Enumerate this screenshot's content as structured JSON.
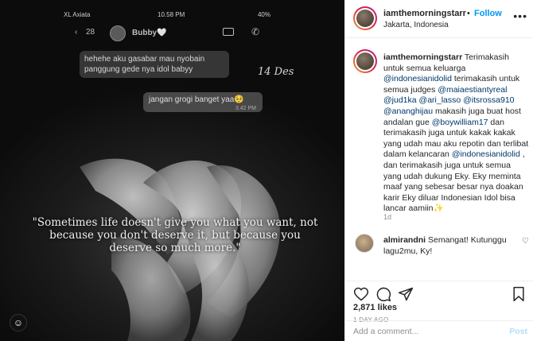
{
  "photo": {
    "status": {
      "carrier": "XL Axiata",
      "time": "10.58 PM",
      "battery": "40%"
    },
    "chat": {
      "back_count": "28",
      "contact": "Bubby🤍"
    },
    "message_in": "hehehe aku gasabar mau nyobain panggung gede nya idol babyy",
    "date_label": "14 Des",
    "message_out": "jangan grogi banget yaa🥺",
    "message_out_time": "3.42 PM",
    "quote": "\"Sometimes life doesn't give you what you want, not because you don't deserve it, but because you deserve so much more.\""
  },
  "header": {
    "username": "iamthemorningstarr",
    "separator": "•",
    "follow_label": "Follow",
    "location": "Jakarta, Indonesia",
    "more": "•••"
  },
  "caption": {
    "username": "iamthemorningstarr",
    "segments": [
      {
        "text": " Terimakasih untuk semua keluarga ",
        "mention": false
      },
      {
        "text": "@indonesianidolid",
        "mention": true
      },
      {
        "text": " terimakasih untuk semua judges ",
        "mention": false
      },
      {
        "text": "@maiaestiantyreal",
        "mention": true
      },
      {
        "text": " ",
        "mention": false
      },
      {
        "text": "@jud1ka",
        "mention": true
      },
      {
        "text": " ",
        "mention": false
      },
      {
        "text": "@ari_lasso",
        "mention": true
      },
      {
        "text": " ",
        "mention": false
      },
      {
        "text": "@itsrossa910",
        "mention": true
      },
      {
        "text": " ",
        "mention": false
      },
      {
        "text": "@ananghijau",
        "mention": true
      },
      {
        "text": " makasih juga buat host andalan gue ",
        "mention": false
      },
      {
        "text": "@boywilliam17",
        "mention": true
      },
      {
        "text": " dan terimakasih juga untuk kakak kakak yang udah mau aku repotin dan terlibat dalam kelancaran ",
        "mention": false
      },
      {
        "text": "@indonesianidolid",
        "mention": true
      },
      {
        "text": " , dan terimakasih juga untuk semua yang udah dukung Eky. Eky meminta maaf yang sebesar besar nya doakan karir Eky diluar Indonesian Idol bisa lancar aamiin✨",
        "mention": false
      }
    ],
    "age": "1d"
  },
  "comment": {
    "username": "almirandni",
    "text": " Semangat! Kutunggu lagu2mu, Ky!"
  },
  "actions": {
    "like_icon": "heart-icon",
    "comment_icon": "comment-icon",
    "share_icon": "share-icon",
    "save_icon": "bookmark-icon"
  },
  "likes": "2,871 likes",
  "posted_ago": "1 DAY AGO",
  "add_comment": {
    "placeholder": "Add a comment...",
    "post_label": "Post"
  },
  "colors": {
    "accent": "#0095f6",
    "mention": "#00376b",
    "muted": "#8e8e8e"
  }
}
